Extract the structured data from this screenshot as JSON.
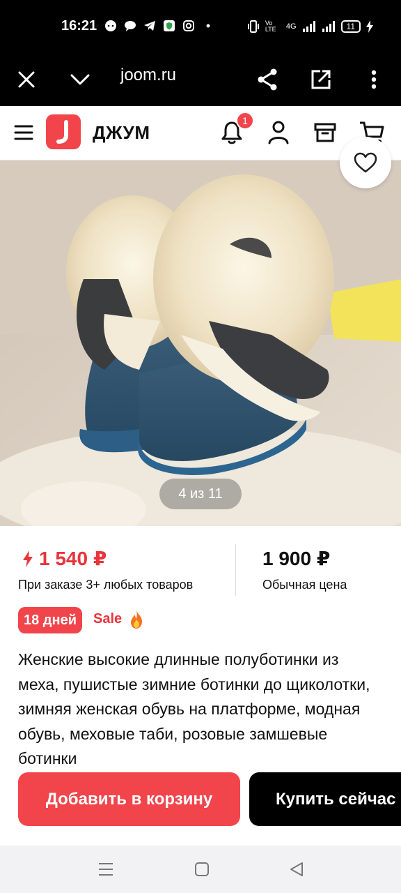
{
  "status_bar": {
    "time": "16:21",
    "network": "4G",
    "volte": "Vo LTE",
    "battery": "11"
  },
  "browser": {
    "url": "joom.ru",
    "icons": [
      "close-icon",
      "chevron-down-icon",
      "share-icon",
      "open-external-icon",
      "more-vertical-icon"
    ]
  },
  "header": {
    "brand": "ДЖУМ",
    "notifications_count": "1",
    "icons": [
      "menu-icon",
      "logo-icon",
      "bell-icon",
      "user-icon",
      "orders-box-icon",
      "cart-icon"
    ]
  },
  "gallery": {
    "counter": "4 из 11",
    "favorite_icon": "heart-icon"
  },
  "pricing": {
    "sale_price": "1 540 ₽",
    "sale_note": "При заказе 3+ любых товаров",
    "regular_price": "1 900 ₽",
    "regular_note": "Обычная цена",
    "days_badge": "18 дней",
    "sale_label": "Sale",
    "colors": {
      "accent": "#f1454b",
      "accent_text": "#e8343c"
    }
  },
  "product": {
    "title": "Женские высокие длинные полуботинки из меха, пушистые зимние ботинки до щиколотки, зимняя женская обувь на платформе, модная обувь, меховые таби, розовые замшевые ботинки"
  },
  "actions": {
    "add_to_cart": "Добавить в корзину",
    "buy_now": "Купить сейчас"
  },
  "system_nav": {
    "icons": [
      "recent-apps-icon",
      "home-icon",
      "back-icon"
    ]
  }
}
